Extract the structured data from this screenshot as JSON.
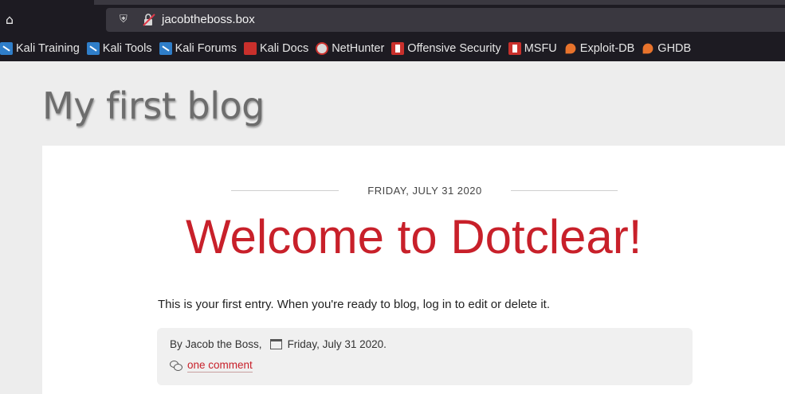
{
  "browser": {
    "url": "jacobtheboss.box",
    "bookmarks": [
      {
        "label": "Kali Training",
        "icon": "kali-dragon-icon"
      },
      {
        "label": "Kali Tools",
        "icon": "kali-dragon-icon"
      },
      {
        "label": "Kali Forums",
        "icon": "kali-dragon-icon"
      },
      {
        "label": "Kali Docs",
        "icon": "kali-docs-icon"
      },
      {
        "label": "NetHunter",
        "icon": "nethunter-icon"
      },
      {
        "label": "Offensive Security",
        "icon": "offsec-icon"
      },
      {
        "label": "MSFU",
        "icon": "offsec-icon"
      },
      {
        "label": "Exploit-DB",
        "icon": "exploitdb-icon"
      },
      {
        "label": "GHDB",
        "icon": "exploitdb-icon"
      }
    ]
  },
  "blog": {
    "title": "My first blog"
  },
  "post": {
    "date": "FRIDAY, JULY 31 2020",
    "title": "Welcome to Dotclear!",
    "body": "This is your first entry. When you're ready to blog, log in to edit or delete it.",
    "author": "By Jacob the Boss,",
    "published": "Friday, July 31 2020.",
    "comments_label": "one comment"
  },
  "colors": {
    "accent": "#c8202a",
    "chrome": "#1d1b22"
  }
}
